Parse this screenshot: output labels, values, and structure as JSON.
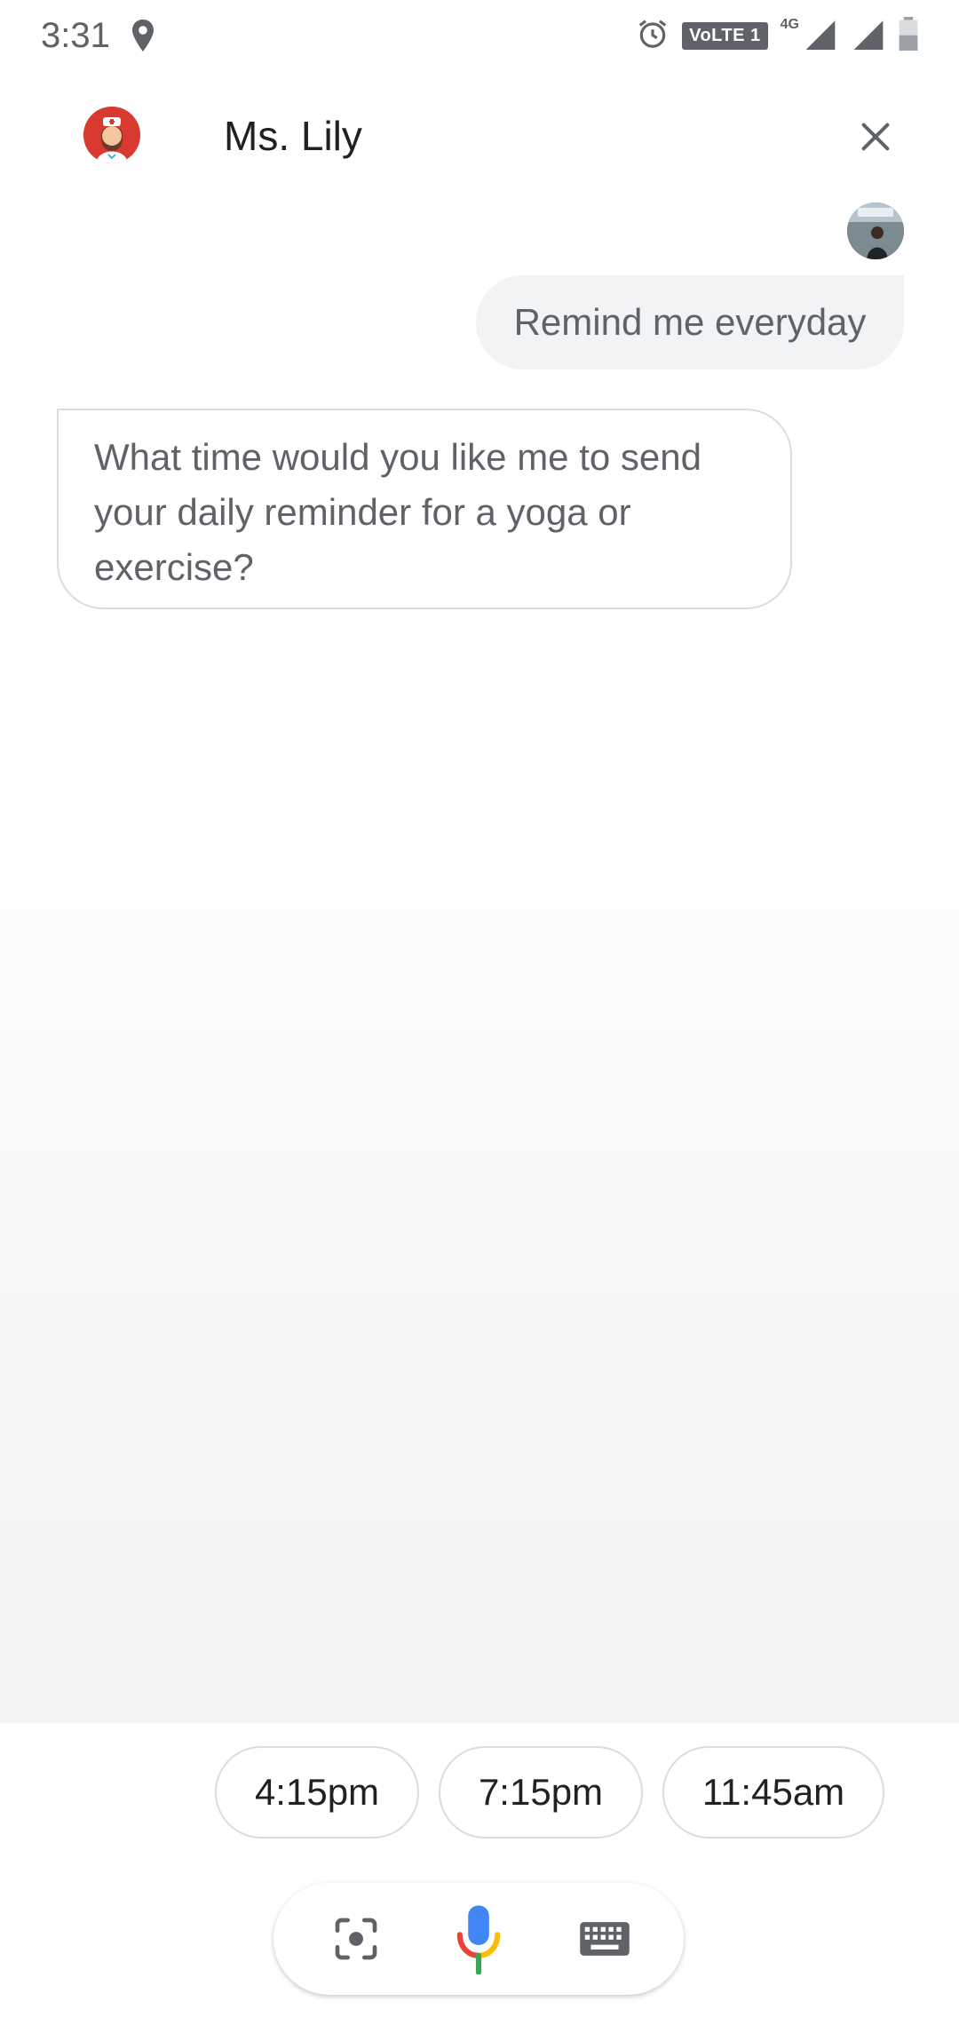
{
  "status_bar": {
    "time": "3:31",
    "volte_label": "VoLTE 1",
    "network_label": "4G"
  },
  "header": {
    "title": "Ms. Lily"
  },
  "conversation": {
    "user_message": "Remind me everyday",
    "bot_message": "What time would you like me to send your daily reminder for a yoga or exercise?"
  },
  "suggestions": [
    {
      "label": "4:15pm"
    },
    {
      "label": "7:15pm"
    },
    {
      "label": "11:45am"
    }
  ],
  "input_bar": {
    "icons": [
      "lens-icon",
      "mic-icon",
      "keyboard-icon"
    ]
  },
  "colors": {
    "accent_blue": "#4285F4",
    "accent_red": "#EA4335",
    "accent_yellow": "#FBBC05",
    "accent_green": "#34A853",
    "bubble_user_bg": "#f1f3f4",
    "bubble_border": "#dadce0"
  }
}
